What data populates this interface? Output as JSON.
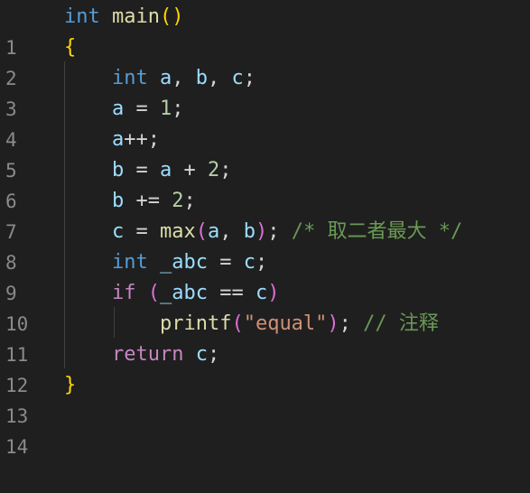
{
  "editor": {
    "line_numbers": [
      "1",
      "2",
      "3",
      "4",
      "5",
      "6",
      "7",
      "8",
      "9",
      "10",
      "11",
      "12",
      "13",
      "14"
    ],
    "lines": [
      {
        "int": "int",
        "main": "main",
        "lp": "(",
        "rp": ")"
      },
      {
        "brace": "{"
      },
      {
        "int": "int",
        "a": "a",
        "sep1": ", ",
        "b": "b",
        "sep2": ", ",
        "c": "c",
        "semi": ";"
      },
      {
        "a": "a",
        "op": " = ",
        "n": "1",
        "semi": ";"
      },
      {
        "a": "a",
        "op": "++;"
      },
      {
        "b": "b",
        "op1": " = ",
        "a": "a",
        "op2": " + ",
        "n": "2",
        "semi": ";"
      },
      {
        "b": "b",
        "op": " += ",
        "n": "2",
        "semi": ";"
      },
      {
        "c": "c",
        "op": " = ",
        "max": "max",
        "lp": "(",
        "a": "a",
        "sep": ", ",
        "b": "b",
        "rp": ")",
        "semi": "; ",
        "comment": "/* 取二者最大 */"
      },
      {
        "int": "int",
        "abc": "_abc",
        "op": " = ",
        "c": "c",
        "semi": ";"
      },
      {
        "if": "if",
        "sp": " ",
        "lp": "(",
        "abc": "_abc",
        "op": " == ",
        "c": "c",
        "rp": ")"
      },
      {
        "printf": "printf",
        "lp": "(",
        "str": "\"equal\"",
        "rp": ")",
        "semi": "; ",
        "comment": "// 注释"
      },
      {
        "ret": "return",
        "sp": " ",
        "c": "c",
        "semi": ";"
      },
      {
        "brace": "}"
      }
    ]
  }
}
